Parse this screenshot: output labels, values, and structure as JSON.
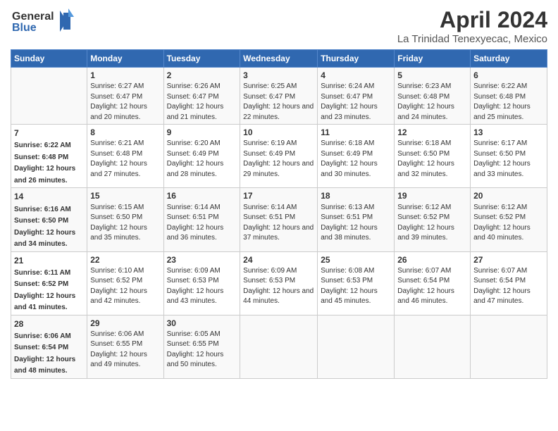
{
  "logo": {
    "line1": "General",
    "line2": "Blue"
  },
  "title": "April 2024",
  "subtitle": "La Trinidad Tenexyecac, Mexico",
  "days_header": [
    "Sunday",
    "Monday",
    "Tuesday",
    "Wednesday",
    "Thursday",
    "Friday",
    "Saturday"
  ],
  "weeks": [
    [
      {
        "num": "",
        "sunrise": "",
        "sunset": "",
        "daylight": ""
      },
      {
        "num": "1",
        "sunrise": "Sunrise: 6:27 AM",
        "sunset": "Sunset: 6:47 PM",
        "daylight": "Daylight: 12 hours and 20 minutes."
      },
      {
        "num": "2",
        "sunrise": "Sunrise: 6:26 AM",
        "sunset": "Sunset: 6:47 PM",
        "daylight": "Daylight: 12 hours and 21 minutes."
      },
      {
        "num": "3",
        "sunrise": "Sunrise: 6:25 AM",
        "sunset": "Sunset: 6:47 PM",
        "daylight": "Daylight: 12 hours and 22 minutes."
      },
      {
        "num": "4",
        "sunrise": "Sunrise: 6:24 AM",
        "sunset": "Sunset: 6:47 PM",
        "daylight": "Daylight: 12 hours and 23 minutes."
      },
      {
        "num": "5",
        "sunrise": "Sunrise: 6:23 AM",
        "sunset": "Sunset: 6:48 PM",
        "daylight": "Daylight: 12 hours and 24 minutes."
      },
      {
        "num": "6",
        "sunrise": "Sunrise: 6:22 AM",
        "sunset": "Sunset: 6:48 PM",
        "daylight": "Daylight: 12 hours and 25 minutes."
      }
    ],
    [
      {
        "num": "7",
        "sunrise": "Sunrise: 6:22 AM",
        "sunset": "Sunset: 6:48 PM",
        "daylight": "Daylight: 12 hours and 26 minutes."
      },
      {
        "num": "8",
        "sunrise": "Sunrise: 6:21 AM",
        "sunset": "Sunset: 6:48 PM",
        "daylight": "Daylight: 12 hours and 27 minutes."
      },
      {
        "num": "9",
        "sunrise": "Sunrise: 6:20 AM",
        "sunset": "Sunset: 6:49 PM",
        "daylight": "Daylight: 12 hours and 28 minutes."
      },
      {
        "num": "10",
        "sunrise": "Sunrise: 6:19 AM",
        "sunset": "Sunset: 6:49 PM",
        "daylight": "Daylight: 12 hours and 29 minutes."
      },
      {
        "num": "11",
        "sunrise": "Sunrise: 6:18 AM",
        "sunset": "Sunset: 6:49 PM",
        "daylight": "Daylight: 12 hours and 30 minutes."
      },
      {
        "num": "12",
        "sunrise": "Sunrise: 6:18 AM",
        "sunset": "Sunset: 6:50 PM",
        "daylight": "Daylight: 12 hours and 32 minutes."
      },
      {
        "num": "13",
        "sunrise": "Sunrise: 6:17 AM",
        "sunset": "Sunset: 6:50 PM",
        "daylight": "Daylight: 12 hours and 33 minutes."
      }
    ],
    [
      {
        "num": "14",
        "sunrise": "Sunrise: 6:16 AM",
        "sunset": "Sunset: 6:50 PM",
        "daylight": "Daylight: 12 hours and 34 minutes."
      },
      {
        "num": "15",
        "sunrise": "Sunrise: 6:15 AM",
        "sunset": "Sunset: 6:50 PM",
        "daylight": "Daylight: 12 hours and 35 minutes."
      },
      {
        "num": "16",
        "sunrise": "Sunrise: 6:14 AM",
        "sunset": "Sunset: 6:51 PM",
        "daylight": "Daylight: 12 hours and 36 minutes."
      },
      {
        "num": "17",
        "sunrise": "Sunrise: 6:14 AM",
        "sunset": "Sunset: 6:51 PM",
        "daylight": "Daylight: 12 hours and 37 minutes."
      },
      {
        "num": "18",
        "sunrise": "Sunrise: 6:13 AM",
        "sunset": "Sunset: 6:51 PM",
        "daylight": "Daylight: 12 hours and 38 minutes."
      },
      {
        "num": "19",
        "sunrise": "Sunrise: 6:12 AM",
        "sunset": "Sunset: 6:52 PM",
        "daylight": "Daylight: 12 hours and 39 minutes."
      },
      {
        "num": "20",
        "sunrise": "Sunrise: 6:12 AM",
        "sunset": "Sunset: 6:52 PM",
        "daylight": "Daylight: 12 hours and 40 minutes."
      }
    ],
    [
      {
        "num": "21",
        "sunrise": "Sunrise: 6:11 AM",
        "sunset": "Sunset: 6:52 PM",
        "daylight": "Daylight: 12 hours and 41 minutes."
      },
      {
        "num": "22",
        "sunrise": "Sunrise: 6:10 AM",
        "sunset": "Sunset: 6:52 PM",
        "daylight": "Daylight: 12 hours and 42 minutes."
      },
      {
        "num": "23",
        "sunrise": "Sunrise: 6:09 AM",
        "sunset": "Sunset: 6:53 PM",
        "daylight": "Daylight: 12 hours and 43 minutes."
      },
      {
        "num": "24",
        "sunrise": "Sunrise: 6:09 AM",
        "sunset": "Sunset: 6:53 PM",
        "daylight": "Daylight: 12 hours and 44 minutes."
      },
      {
        "num": "25",
        "sunrise": "Sunrise: 6:08 AM",
        "sunset": "Sunset: 6:53 PM",
        "daylight": "Daylight: 12 hours and 45 minutes."
      },
      {
        "num": "26",
        "sunrise": "Sunrise: 6:07 AM",
        "sunset": "Sunset: 6:54 PM",
        "daylight": "Daylight: 12 hours and 46 minutes."
      },
      {
        "num": "27",
        "sunrise": "Sunrise: 6:07 AM",
        "sunset": "Sunset: 6:54 PM",
        "daylight": "Daylight: 12 hours and 47 minutes."
      }
    ],
    [
      {
        "num": "28",
        "sunrise": "Sunrise: 6:06 AM",
        "sunset": "Sunset: 6:54 PM",
        "daylight": "Daylight: 12 hours and 48 minutes."
      },
      {
        "num": "29",
        "sunrise": "Sunrise: 6:06 AM",
        "sunset": "Sunset: 6:55 PM",
        "daylight": "Daylight: 12 hours and 49 minutes."
      },
      {
        "num": "30",
        "sunrise": "Sunrise: 6:05 AM",
        "sunset": "Sunset: 6:55 PM",
        "daylight": "Daylight: 12 hours and 50 minutes."
      },
      {
        "num": "",
        "sunrise": "",
        "sunset": "",
        "daylight": ""
      },
      {
        "num": "",
        "sunrise": "",
        "sunset": "",
        "daylight": ""
      },
      {
        "num": "",
        "sunrise": "",
        "sunset": "",
        "daylight": ""
      },
      {
        "num": "",
        "sunrise": "",
        "sunset": "",
        "daylight": ""
      }
    ]
  ]
}
